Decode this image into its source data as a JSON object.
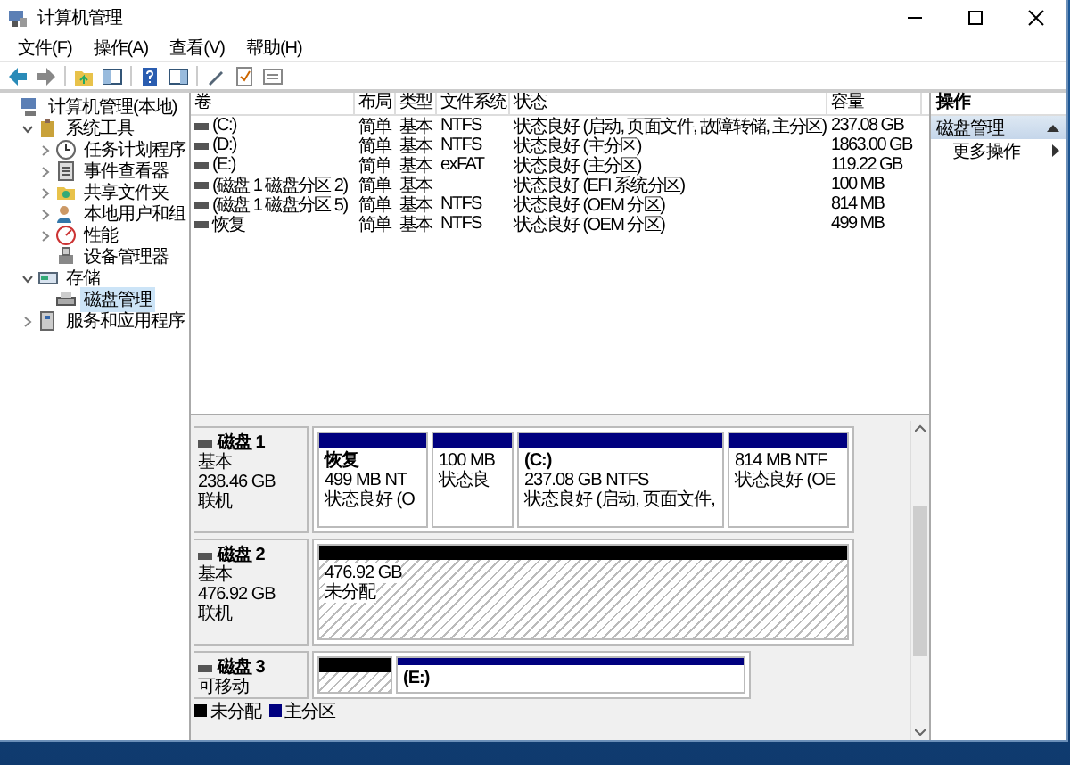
{
  "window": {
    "title": "计算机管理"
  },
  "menu": [
    "文件(F)",
    "操作(A)",
    "查看(V)",
    "帮助(H)"
  ],
  "tree": [
    {
      "label": "计算机管理(本地)",
      "selected": false,
      "children": [
        {
          "label": "系统工具",
          "expanded": true,
          "selected": false,
          "children": [
            {
              "label": "任务计划程序",
              "expanded": false,
              "selected": false
            },
            {
              "label": "事件查看器",
              "expanded": false,
              "selected": false
            },
            {
              "label": "共享文件夹",
              "expanded": false,
              "selected": false
            },
            {
              "label": "本地用户和组",
              "expanded": false,
              "selected": false
            },
            {
              "label": "性能",
              "expanded": false,
              "selected": false
            },
            {
              "label": "设备管理器",
              "selected": false
            }
          ]
        },
        {
          "label": "存储",
          "expanded": true,
          "selected": false,
          "children": [
            {
              "label": "磁盘管理",
              "selected": true
            }
          ]
        },
        {
          "label": "服务和应用程序",
          "expanded": false,
          "selected": false
        }
      ]
    }
  ],
  "volumes": {
    "columns": [
      "卷",
      "布局",
      "类型",
      "文件系统",
      "状态",
      "容量"
    ],
    "rows": [
      [
        "(C:)",
        "简单",
        "基本",
        "NTFS",
        "状态良好 (启动, 页面文件, 故障转储, 主分区)",
        "237.08 GB"
      ],
      [
        "(D:)",
        "简单",
        "基本",
        "NTFS",
        "状态良好 (主分区)",
        "1863.00 GB"
      ],
      [
        "(E:)",
        "简单",
        "基本",
        "exFAT",
        "状态良好 (主分区)",
        "119.22 GB"
      ],
      [
        "(磁盘 1 磁盘分区 2)",
        "简单",
        "基本",
        "",
        "状态良好 (EFI 系统分区)",
        "100 MB"
      ],
      [
        "(磁盘 1 磁盘分区 5)",
        "简单",
        "基本",
        "NTFS",
        "状态良好 (OEM 分区)",
        "814 MB"
      ],
      [
        "恢复",
        "简单",
        "基本",
        "NTFS",
        "状态良好 (OEM 分区)",
        "499 MB"
      ]
    ]
  },
  "disks": [
    {
      "name": "磁盘 1",
      "type": "基本",
      "size": "238.46 GB",
      "status": "联机",
      "partitions": [
        {
          "kind": "primary",
          "label": "恢复",
          "size": "499 MB NT",
          "status": "状态良好 (O"
        },
        {
          "kind": "primary",
          "size": "100 MB",
          "status": "状态良"
        },
        {
          "kind": "primary",
          "label": "(C:)",
          "size": "237.08 GB NTFS",
          "status": "状态良好 (启动, 页面文件,"
        },
        {
          "kind": "primary",
          "size": "814 MB NTF",
          "status": "状态良好 (OE"
        }
      ]
    },
    {
      "name": "磁盘 2",
      "type": "基本",
      "size": "476.92 GB",
      "status": "联机",
      "partitions": [
        {
          "kind": "unallocated",
          "size": "476.92 GB",
          "status": "未分配"
        }
      ]
    },
    {
      "name": "磁盘 3",
      "type": "可移动",
      "partitions": [
        {
          "kind": "unallocated"
        },
        {
          "kind": "primary",
          "label": "(E:)"
        }
      ]
    }
  ],
  "legend": [
    {
      "label": "未分配",
      "color": "#000000"
    },
    {
      "label": "主分区",
      "color": "#00007f"
    }
  ],
  "actions": {
    "title": "操作",
    "section": {
      "label": "磁盘管理",
      "expanded": true
    },
    "items": [
      "更多操作"
    ]
  }
}
